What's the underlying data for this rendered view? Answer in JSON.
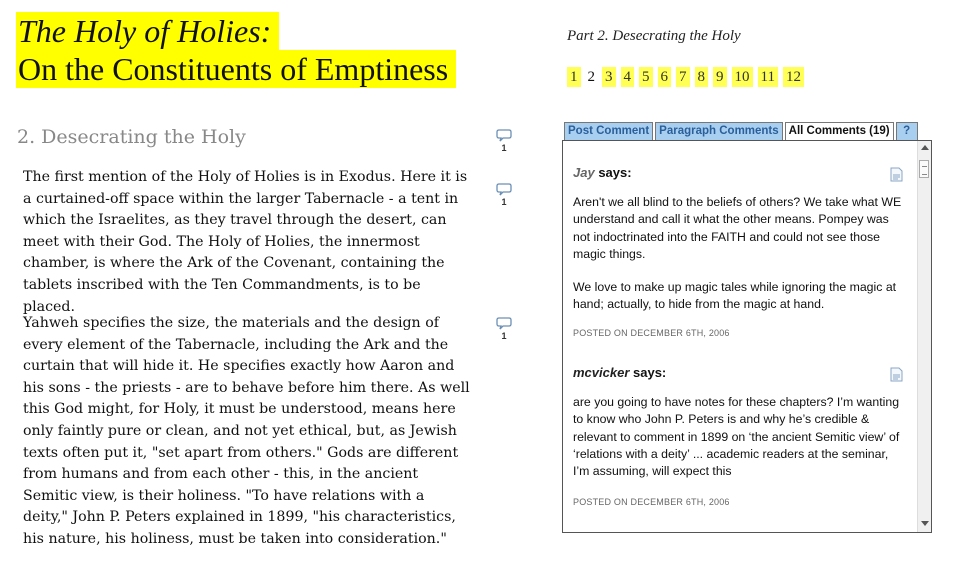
{
  "header": {
    "title_line1": "The Holy of Holies:",
    "title_line2": "On the Constituents of Emptiness"
  },
  "part": {
    "title": "Part 2. Desecrating the Holy",
    "pages": [
      "1",
      "2",
      "3",
      "4",
      "5",
      "6",
      "7",
      "8",
      "9",
      "10",
      "11",
      "12"
    ],
    "current_page": "2"
  },
  "section": {
    "heading": "2. Desecrating the Holy",
    "heading_comment_count": "1",
    "paragraphs": [
      {
        "text": "The first mention of the Holy of Holies is in Exodus. Here it is a curtained-off space within the larger Tabernacle - a tent in which the Israelites, as they travel through the desert, can meet with their God. The Holy of Holies, the innermost chamber, is where the Ark of the Covenant, containing the tablets inscribed with the Ten Commandments, is to be placed.",
        "comment_count": "1"
      },
      {
        "text": "Yahweh specifies the size, the materials and the design of every element of the Tabernacle, including the Ark and the curtain that will hide it. He specifies exactly how Aaron and his sons - the priests - are to behave before him there. As well this God might, for Holy, it must be understood, means here only faintly pure or clean, and not yet ethical, but, as Jewish texts often put it, \"set apart from others.\" Gods are different from humans and from each other - this, in the ancient Semitic view, is their holiness. \"To have relations with a deity,\" John P. Peters explained in 1899, \"his characteristics, his nature, his holiness, must be taken into consideration.\"",
        "comment_count": "1"
      }
    ]
  },
  "comments_panel": {
    "tabs": {
      "post": "Post Comment",
      "paragraph": "Paragraph Comments",
      "all": "All Comments (19)",
      "help": "?"
    },
    "comments": [
      {
        "author": "Jay",
        "says": "says:",
        "paragraphs": [
          "Aren't we all blind to the beliefs of others? We take what WE understand and call it what the other means. Pompey was not indoctrinated into the FAITH and could not see those magic things.",
          "We love to make up magic tales while ignoring the magic at hand; actually, to hide from the magic at hand."
        ],
        "posted": "POSTED ON DECEMBER 6TH, 2006"
      },
      {
        "author": "mcvicker",
        "says": "says:",
        "paragraphs": [
          "are you going to have notes for these chapters? I’m wanting to know who John P. Peters is and why he’s credible & relevant to comment in 1899 on ‘the ancient Semitic view’ of ‘relations with a deity’ ... academic readers at the seminar, I’m assuming, will expect this"
        ],
        "posted": "POSTED ON DECEMBER 6TH, 2006"
      }
    ]
  },
  "colors": {
    "highlight": "#ffff00",
    "tab_blue": "#a9cff0",
    "heading_grey": "#888888"
  },
  "icons": {
    "comment_bubble": "speech-bubble-icon",
    "comment_document": "document-icon"
  }
}
